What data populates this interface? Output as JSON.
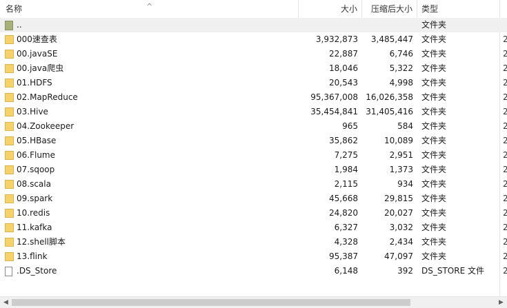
{
  "columns": {
    "name": "名称",
    "size": "大小",
    "compressed_size": "压缩后大小",
    "type": "类型",
    "sort_indicator": "^"
  },
  "rows": [
    {
      "icon": "folder-up-icon",
      "name": "..",
      "size": "",
      "compressed": "",
      "type": "文件夹",
      "more": ""
    },
    {
      "icon": "folder-icon",
      "name": "000速查表",
      "size": "3,932,873",
      "compressed": "3,485,447",
      "type": "文件夹",
      "more": "2"
    },
    {
      "icon": "folder-icon",
      "name": "00.javaSE",
      "size": "22,887",
      "compressed": "6,746",
      "type": "文件夹",
      "more": "2"
    },
    {
      "icon": "folder-icon",
      "name": "00.java爬虫",
      "size": "18,046",
      "compressed": "5,322",
      "type": "文件夹",
      "more": "2"
    },
    {
      "icon": "folder-icon",
      "name": "01.HDFS",
      "size": "20,543",
      "compressed": "4,998",
      "type": "文件夹",
      "more": "2"
    },
    {
      "icon": "folder-icon",
      "name": "02.MapReduce",
      "size": "95,367,008",
      "compressed": "16,026,358",
      "type": "文件夹",
      "more": "2"
    },
    {
      "icon": "folder-icon",
      "name": "03.Hive",
      "size": "35,454,841",
      "compressed": "31,405,416",
      "type": "文件夹",
      "more": "2"
    },
    {
      "icon": "folder-icon",
      "name": "04.Zookeeper",
      "size": "965",
      "compressed": "584",
      "type": "文件夹",
      "more": "2"
    },
    {
      "icon": "folder-icon",
      "name": "05.HBase",
      "size": "35,862",
      "compressed": "10,089",
      "type": "文件夹",
      "more": "2"
    },
    {
      "icon": "folder-icon",
      "name": "06.Flume",
      "size": "7,275",
      "compressed": "2,951",
      "type": "文件夹",
      "more": "2"
    },
    {
      "icon": "folder-icon",
      "name": "07.sqoop",
      "size": "1,984",
      "compressed": "1,373",
      "type": "文件夹",
      "more": "2"
    },
    {
      "icon": "folder-icon",
      "name": "08.scala",
      "size": "2,115",
      "compressed": "934",
      "type": "文件夹",
      "more": "2"
    },
    {
      "icon": "folder-icon",
      "name": "09.spark",
      "size": "45,668",
      "compressed": "29,815",
      "type": "文件夹",
      "more": "2"
    },
    {
      "icon": "folder-icon",
      "name": "10.redis",
      "size": "24,820",
      "compressed": "20,027",
      "type": "文件夹",
      "more": "2"
    },
    {
      "icon": "folder-icon",
      "name": "11.kafka",
      "size": "6,327",
      "compressed": "3,032",
      "type": "文件夹",
      "more": "2"
    },
    {
      "icon": "folder-icon",
      "name": "12.shell脚本",
      "size": "4,328",
      "compressed": "2,434",
      "type": "文件夹",
      "more": "2"
    },
    {
      "icon": "folder-icon",
      "name": "13.flink",
      "size": "95,387",
      "compressed": "47,097",
      "type": "文件夹",
      "more": "2"
    },
    {
      "icon": "file-icon",
      "name": ".DS_Store",
      "size": "6,148",
      "compressed": "392",
      "type": "DS_STORE 文件",
      "more": "2"
    }
  ],
  "scrollbar": {
    "left_arrow": "◀",
    "right_arrow": "▶"
  },
  "colors": {
    "folder": "#f5d26b",
    "header_border": "#e5e5e5",
    "scroll_thumb": "#cdcdcd"
  }
}
